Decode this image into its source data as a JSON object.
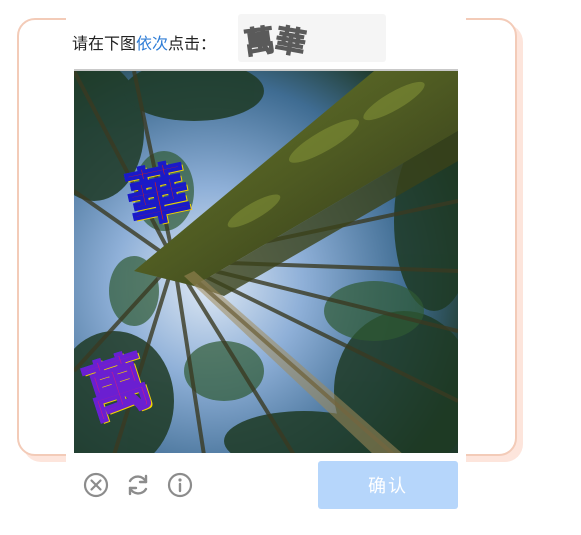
{
  "prompt": {
    "part1": "请在下图",
    "accent": "依次",
    "part2": "点击："
  },
  "target_chars": [
    "萬",
    "華"
  ],
  "captcha": {
    "overlay_chars": [
      "華",
      "萬"
    ]
  },
  "controls": {
    "close_icon": "close-circle-icon",
    "refresh_icon": "refresh-icon",
    "info_icon": "info-circle-icon",
    "confirm_label": "确认"
  },
  "colors": {
    "accent": "#2f7dd6",
    "confirm_bg": "#b6d6fb",
    "frame_border": "#f3cbb8",
    "icon_gray": "#8c8c8c"
  }
}
